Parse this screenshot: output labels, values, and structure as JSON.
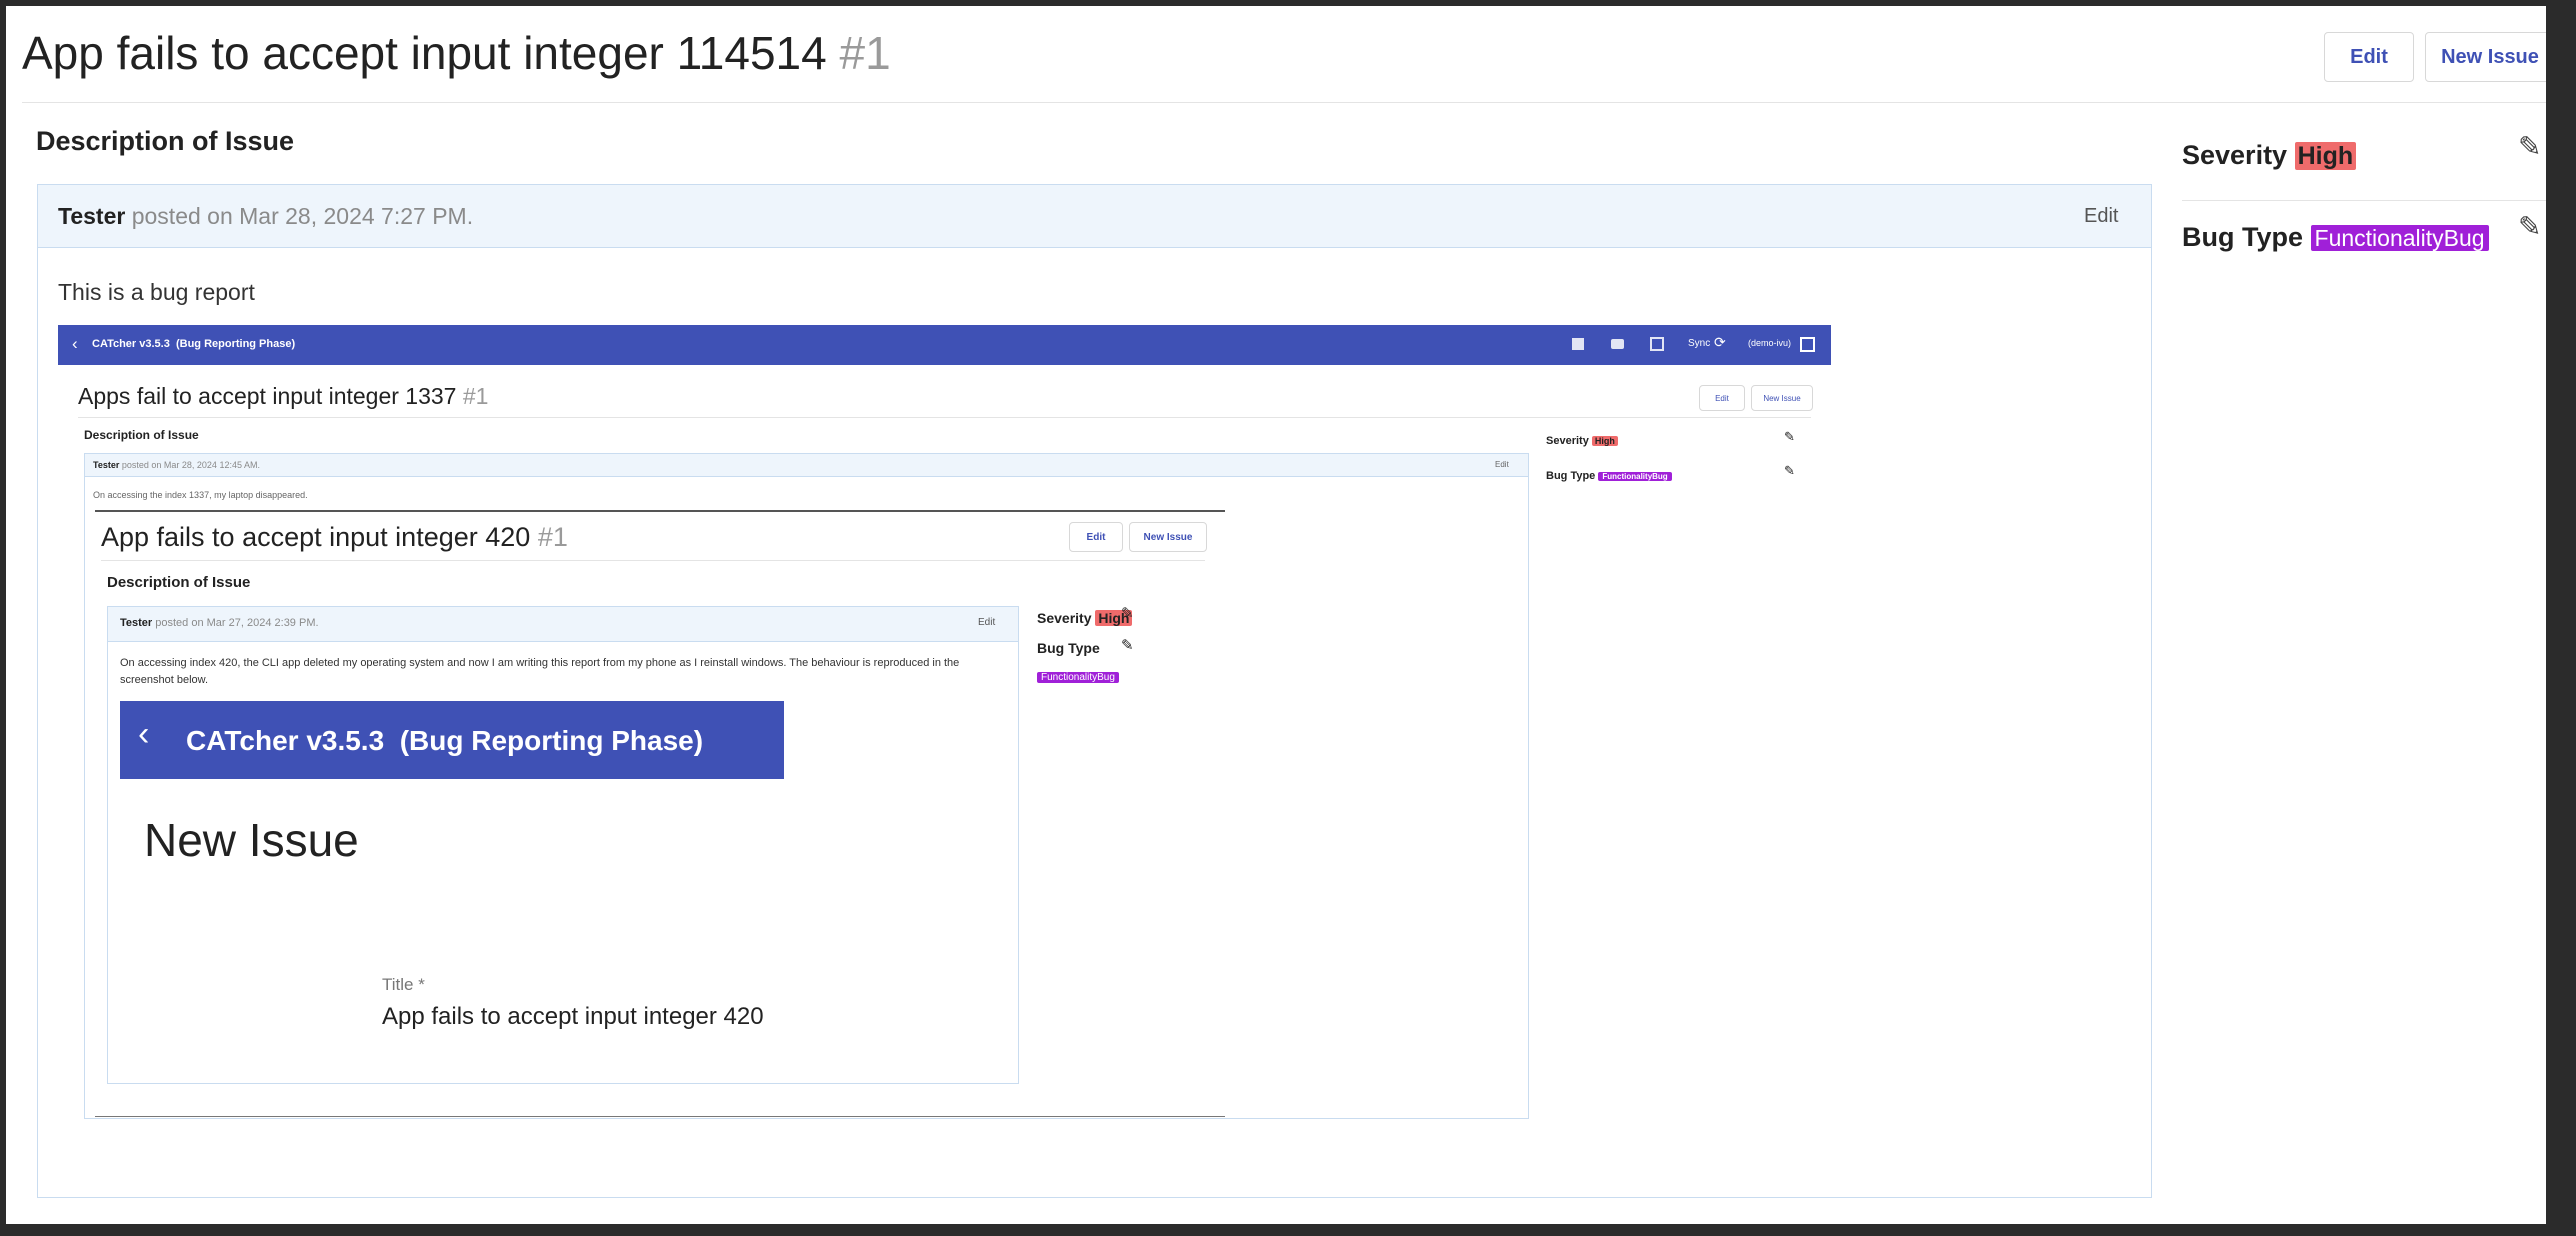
{
  "issue": {
    "title": "App fails to accept input integer 114514",
    "number": "#1",
    "edit_label": "Edit",
    "new_issue_label": "New Issue",
    "description_heading": "Description of Issue"
  },
  "comment": {
    "author": "Tester",
    "posted_text": "posted on Mar 28, 2024 7:27 PM.",
    "edit_label": "Edit",
    "body": "This is a bug report"
  },
  "sidebar": {
    "severity_label": "Severity",
    "severity_value": "High",
    "bug_type_label": "Bug Type",
    "bug_type_value": "FunctionalityBug"
  },
  "screenshot_1": {
    "app_bar_title": "CATcher v3.5.3  (Bug Reporting Phase)",
    "sync_label": "Sync",
    "user_label": "(demo-ivu)",
    "title": "Apps fail to accept input integer 1337",
    "number": "#1",
    "edit_label": "Edit",
    "new_issue_label": "New Issue",
    "description_heading": "Description of Issue",
    "comment_author": "Tester",
    "comment_posted": "posted on Mar 28, 2024 12:45 AM.",
    "comment_edit": "Edit",
    "comment_body": "On accessing the index 1337, my laptop disappeared.",
    "severity_label": "Severity",
    "severity_value": "High",
    "bug_type_label": "Bug Type",
    "bug_type_value": "FunctionalityBug"
  },
  "screenshot_2": {
    "title": "App fails to accept input integer 420",
    "number": "#1",
    "edit_label": "Edit",
    "new_issue_label": "New Issue",
    "description_heading": "Description of Issue",
    "comment_author": "Tester",
    "comment_posted": "posted on Mar 27, 2024 2:39 PM.",
    "comment_edit": "Edit",
    "comment_body": "On accessing index 420, the CLI app deleted my operating system and now I am writing this report from my phone as I reinstall windows. The behaviour is reproduced in the screenshot below.",
    "severity_label": "Severity",
    "severity_value": "High",
    "bug_type_label": "Bug Type",
    "bug_type_value": "FunctionalityBug"
  },
  "screenshot_3": {
    "app_bar_title": "CATcher v3.5.3  (Bug Reporting Phase)",
    "page_title": "New Issue",
    "field_label": "Title *",
    "field_value": "App fails to accept input integer 420"
  },
  "colors": {
    "brand": "#3f51b5",
    "severity_high": "#ef6b6b",
    "functionality_bug": "#a020d8",
    "comment_header_bg": "#eef5fc"
  },
  "icons": [
    "pencil-icon",
    "chevron-left-icon",
    "sync-icon",
    "logout-icon"
  ]
}
